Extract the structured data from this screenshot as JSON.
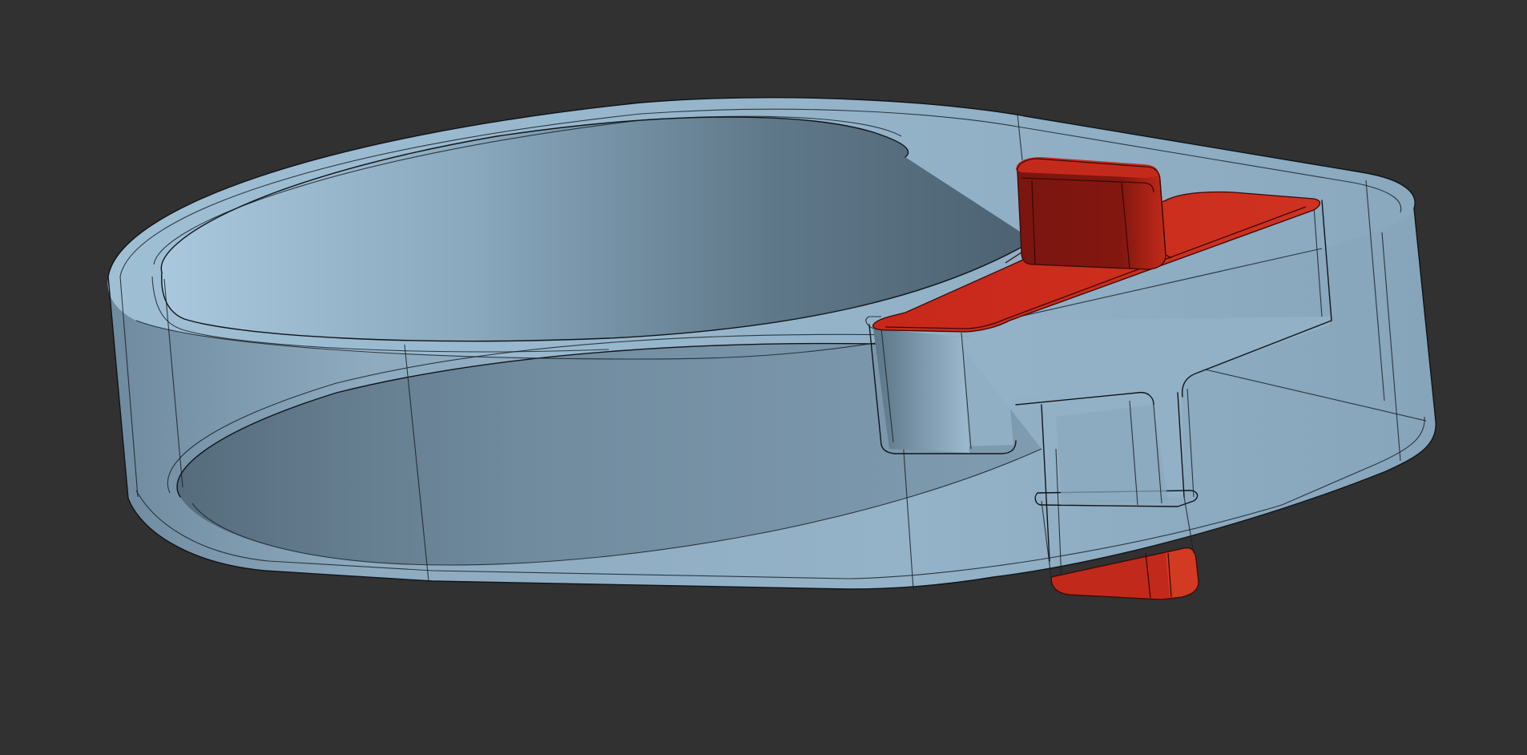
{
  "viewport": {
    "background_color": "#313131",
    "model": {
      "body_part": {
        "name": "clamp-ring",
        "face_color": "#8fb0c8",
        "shadow_color": "#5a7386",
        "highlight_color": "#b4d2e6",
        "edge_color": "#101418"
      },
      "highlighted_part": {
        "name": "t-key-insert",
        "face_color": "#c42a1c",
        "dark_color": "#7a1510",
        "edge_color": "#3a0a06"
      }
    }
  }
}
